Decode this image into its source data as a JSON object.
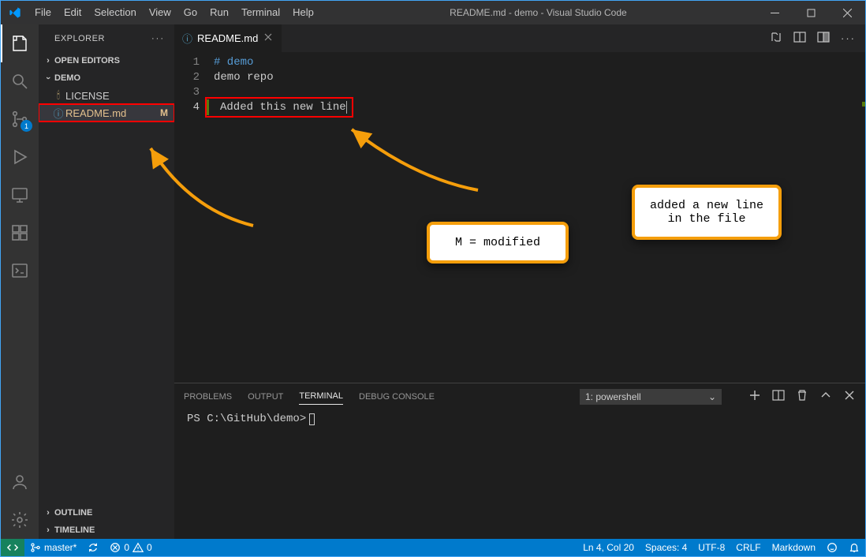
{
  "titlebar": {
    "menus": [
      "File",
      "Edit",
      "Selection",
      "View",
      "Go",
      "Run",
      "Terminal",
      "Help"
    ],
    "title": "README.md - demo - Visual Studio Code"
  },
  "activity": {
    "scm_badge": "1"
  },
  "sidebar": {
    "title": "EXPLORER",
    "open_editors": "OPEN EDITORS",
    "project": "DEMO",
    "files": [
      {
        "name": "LICENSE",
        "icon": "license",
        "status": ""
      },
      {
        "name": "README.md",
        "icon": "info",
        "status": "M",
        "modified": true,
        "hl": true
      }
    ],
    "outline": "OUTLINE",
    "timeline": "TIMELINE"
  },
  "tab": {
    "label": "README.md"
  },
  "editor": {
    "lines": {
      "l1": "# demo",
      "l2": "demo repo",
      "l3": "",
      "l4": "Added this new line"
    },
    "line_numbers": [
      "1",
      "2",
      "3",
      "4"
    ]
  },
  "panel": {
    "tabs": {
      "problems": "PROBLEMS",
      "output": "OUTPUT",
      "terminal": "TERMINAL",
      "debug": "DEBUG CONSOLE"
    },
    "select": "1: powershell",
    "prompt": "PS C:\\GitHub\\demo>"
  },
  "statusbar": {
    "branch": "master*",
    "sync": "",
    "errors": "0",
    "warnings": "0",
    "position": "Ln 4, Col 20",
    "spaces": "Spaces: 4",
    "encoding": "UTF-8",
    "eol": "CRLF",
    "lang": "Markdown"
  },
  "callouts": {
    "c1": "M = modified",
    "c2": "added a new line in the file"
  }
}
